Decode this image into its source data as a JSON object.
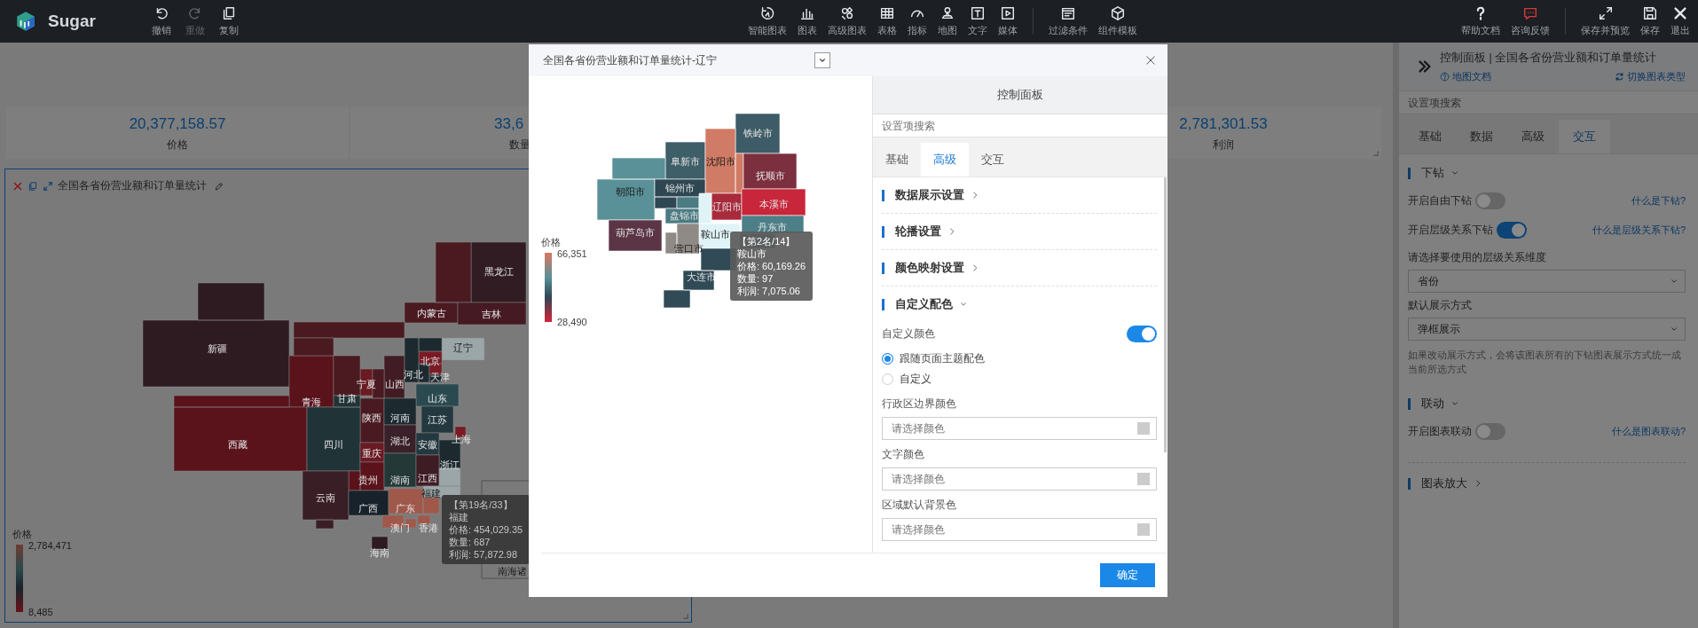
{
  "top_bar": {
    "brand": "Sugar",
    "edit_tools": [
      {
        "label": "撤销",
        "disabled": false
      },
      {
        "label": "重做",
        "disabled": true
      },
      {
        "label": "复制",
        "disabled": false
      }
    ],
    "insert_tools": [
      {
        "label": "智能图表"
      },
      {
        "label": "图表"
      },
      {
        "label": "高级图表"
      },
      {
        "label": "表格"
      },
      {
        "label": "指标"
      },
      {
        "label": "地图"
      },
      {
        "label": "文字"
      },
      {
        "label": "媒体"
      }
    ],
    "filter_tools": [
      {
        "label": "过滤条件"
      },
      {
        "label": "组件模板"
      }
    ],
    "help_tools": [
      {
        "label": "帮助文档"
      },
      {
        "label": "咨询反馈"
      }
    ],
    "action_tools": [
      {
        "label": "保存并预览"
      },
      {
        "label": "保存"
      },
      {
        "label": "退出"
      }
    ]
  },
  "kpi_cards": [
    {
      "value": "20,377,158.57",
      "label": "价格"
    },
    {
      "value": "33,6",
      "label": "数量"
    },
    {
      "value": "2,781,301.53",
      "label": "利润"
    }
  ],
  "chart_card": {
    "title": "全国各省份营业额和订单量统计",
    "regions": [
      {
        "name": "黑龙江",
        "color": "#301c22"
      },
      {
        "name": "内蒙古",
        "color": "#4a1a20"
      },
      {
        "name": "吉林",
        "color": "#461a22"
      },
      {
        "name": "新疆",
        "color": "#2e1b21"
      },
      {
        "name": "辽宁",
        "color": "#9ba6a8"
      },
      {
        "name": "北京",
        "color": "#7a1a24"
      },
      {
        "name": "宁夏",
        "color": "#6a1a22"
      },
      {
        "name": "山西",
        "color": "#421c24"
      },
      {
        "name": "河北",
        "color": "#1c2a30"
      },
      {
        "name": "天津",
        "color": "#7a1a24"
      },
      {
        "name": "青海",
        "color": "#5a121b"
      },
      {
        "name": "甘肃",
        "color": "#4a1a20"
      },
      {
        "name": "山东",
        "color": "#2a4a50"
      },
      {
        "name": "陕西",
        "color": "#4a1a22"
      },
      {
        "name": "河南",
        "color": "#1c2a30"
      },
      {
        "name": "江苏",
        "color": "#243840"
      },
      {
        "name": "西藏",
        "color": "#5a121b"
      },
      {
        "name": "四川",
        "color": "#203438"
      },
      {
        "name": "重庆",
        "color": "#6a1a22"
      },
      {
        "name": "湖北",
        "color": "#3a2028"
      },
      {
        "name": "安徽",
        "color": "#243840"
      },
      {
        "name": "上海",
        "color": "#7a1a24"
      },
      {
        "name": "浙江",
        "color": "#1c2a30"
      },
      {
        "name": "贵州",
        "color": "#5a121b"
      },
      {
        "name": "湖南",
        "color": "#243838"
      },
      {
        "name": "江西",
        "color": "#3e1c24"
      },
      {
        "name": "云南",
        "color": "#3a1e26"
      },
      {
        "name": "福建",
        "color": "#9ba6a8"
      },
      {
        "name": "广西",
        "color": "#18222a"
      },
      {
        "name": "广东",
        "color": "#a0584a"
      },
      {
        "name": "澳门",
        "color": "#a0584a"
      },
      {
        "name": "香港",
        "color": "#a0584a"
      },
      {
        "name": "海南",
        "color": "#2e1b21"
      }
    ],
    "inset_label": "南海诸",
    "legend": {
      "title": "价格",
      "max": "2,784,471",
      "min": "8,485"
    },
    "tooltip": [
      "【第19名/33】",
      "福建",
      "价格: 454,029.35",
      "数量: 687",
      "利润: 57,872.98"
    ]
  },
  "sidebar": {
    "title": "控制面板 | 全国各省份营业额和订单量统计",
    "doc_link": "地图文档",
    "switch_link": "切换图表类型",
    "search_placeholder": "设置项搜索",
    "tabs": [
      {
        "label": "基础",
        "selected": false
      },
      {
        "label": "数据",
        "selected": false
      },
      {
        "label": "高级",
        "selected": false
      },
      {
        "label": "交互",
        "selected": true
      }
    ],
    "groups": [
      {
        "title": "下钻",
        "expanded": true,
        "items": [
          {
            "kind": "toggle",
            "label": "开启自由下钻",
            "on": false,
            "help": "什么是下钻?"
          },
          {
            "kind": "toggle",
            "label": "开启层级关系下钻",
            "on": true,
            "help": "什么是层级关系下钻?"
          },
          {
            "kind": "select",
            "label": "请选择要使用的层级关系维度",
            "value": "省份"
          },
          {
            "kind": "select",
            "label": "默认展示方式",
            "value": "弹框展示"
          },
          {
            "kind": "hint",
            "text": "如果改动展示方式，会将该图表所有的下钻图表展示方式统一成当前所选方式"
          }
        ]
      },
      {
        "title": "联动",
        "expanded": true,
        "items": [
          {
            "kind": "toggle",
            "label": "开启图表联动",
            "on": false,
            "help": "什么是图表联动?"
          }
        ]
      },
      {
        "title": "图表放大",
        "expanded": false
      }
    ]
  },
  "modal": {
    "title": "全国各省份营业额和订单量统计-辽宁",
    "regions": [
      {
        "name": "铁岭市",
        "color": "#3d5c67"
      },
      {
        "name": "阜新市",
        "color": "#3e5e68"
      },
      {
        "name": "沈阳市",
        "color": "#d07b65"
      },
      {
        "name": "抚顺市",
        "color": "#7c2f3e"
      },
      {
        "name": "朝阳市",
        "color": "#5a9198"
      },
      {
        "name": "锦州市",
        "color": "#2f4753"
      },
      {
        "name": "盘锦市",
        "color": "#4b7b83"
      },
      {
        "name": "辽阳市",
        "color": "#a82a3b"
      },
      {
        "name": "本溪市",
        "color": "#c8263a"
      },
      {
        "name": "葫芦岛市",
        "color": "#5b3545"
      },
      {
        "name": "鞍山市",
        "color": "#e0f4f7"
      },
      {
        "name": "丹东市",
        "color": "#4c7f87"
      },
      {
        "name": "营口市",
        "color": "#8f8a86"
      },
      {
        "name": "大连市",
        "color": "#304a56"
      }
    ],
    "legend": {
      "title": "价格",
      "max": "66,351",
      "min": "28,490"
    },
    "tooltip": [
      "【第2名/14】",
      "鞍山市",
      "价格: 60,169.26",
      "数量: 97",
      "利润: 7,075.06"
    ],
    "panel": {
      "header": "控制面板",
      "search_placeholder": "设置项搜索",
      "tabs": [
        {
          "label": "基础",
          "selected": false
        },
        {
          "label": "高级",
          "selected": true
        },
        {
          "label": "交互",
          "selected": false
        }
      ],
      "sections": [
        {
          "title": "数据展示设置",
          "expanded": false
        },
        {
          "title": "轮播设置",
          "expanded": false
        },
        {
          "title": "颜色映射设置",
          "expanded": false
        },
        {
          "title": "自定义配色",
          "expanded": true
        }
      ],
      "custom_color": {
        "label": "自定义颜色",
        "on": true
      },
      "radios": [
        {
          "label": "跟随页面主题配色",
          "selected": true
        },
        {
          "label": "自定义",
          "selected": false
        }
      ],
      "color_fields": [
        {
          "label": "行政区边界颜色",
          "placeholder": "请选择颜色"
        },
        {
          "label": "文字颜色",
          "placeholder": "请选择颜色"
        },
        {
          "label": "区域默认背景色",
          "placeholder": "请选择颜色"
        }
      ]
    },
    "confirm_button": "确定"
  }
}
